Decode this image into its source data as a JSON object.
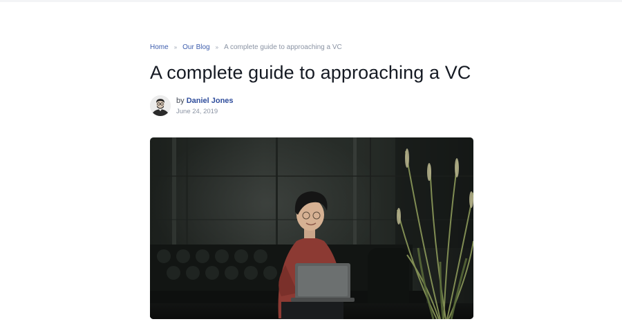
{
  "breadcrumb": {
    "home": "Home",
    "blog": "Our Blog",
    "current": "A complete guide to approaching a VC"
  },
  "post": {
    "title": "A complete guide to approaching a VC",
    "by_label": "by",
    "author": "Daniel Jones",
    "date": "June 24, 2019"
  },
  "colors": {
    "link": "#3d5dad",
    "author_link": "#2f4d9c",
    "muted": "#8a93a3",
    "title": "#151a23"
  }
}
